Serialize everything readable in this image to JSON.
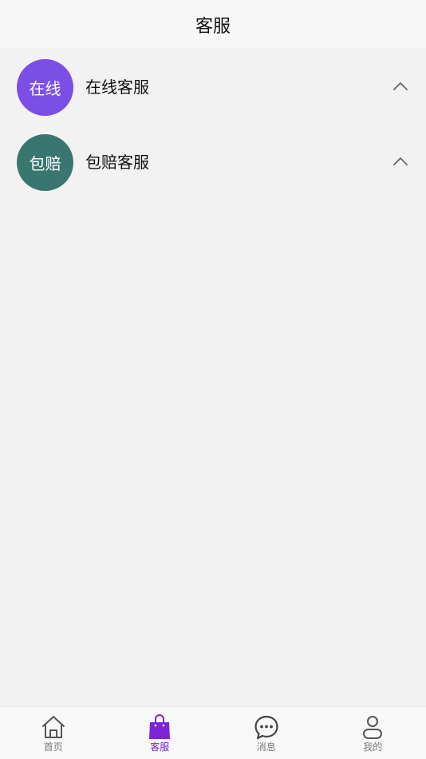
{
  "header": {
    "title": "客服"
  },
  "services": [
    {
      "avatar_text": "在线",
      "label": "在线客服",
      "avatar_color": "#7b4fe6"
    },
    {
      "avatar_text": "包赔",
      "label": "包赔客服",
      "avatar_color": "#3a7670"
    }
  ],
  "tabbar": {
    "tabs": [
      {
        "label": "首页",
        "icon": "home-icon",
        "active": false
      },
      {
        "label": "客服",
        "icon": "shopping-bag-icon",
        "active": true
      },
      {
        "label": "消息",
        "icon": "chat-bubble-icon",
        "active": false
      },
      {
        "label": "我的",
        "icon": "person-icon",
        "active": false
      }
    ],
    "active_color": "#7a24d6",
    "inactive_color": "#7a7a7a"
  }
}
